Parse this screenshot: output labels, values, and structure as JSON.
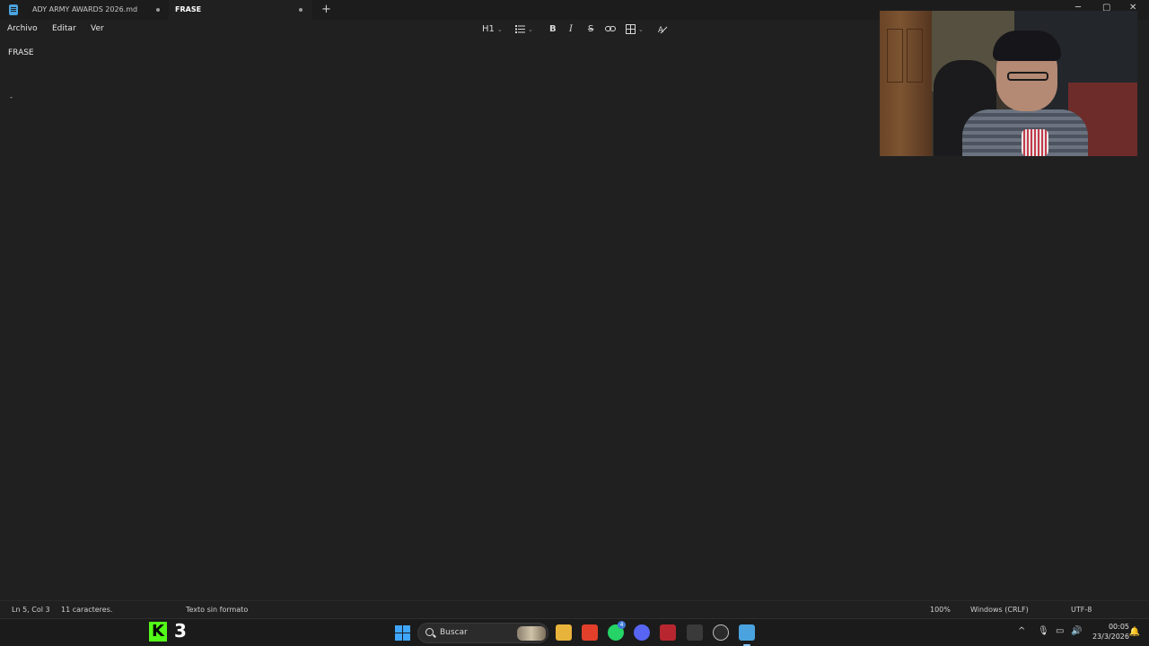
{
  "tabs": [
    {
      "label": "ADY ARMY AWARDS 2026.md",
      "active": false
    },
    {
      "label": "FRASE",
      "active": true
    }
  ],
  "new_tab_symbol": "+",
  "window_controls": {
    "minimize": "─",
    "maximize": "▢",
    "close": "✕"
  },
  "menu": {
    "file": "Archivo",
    "edit": "Editar",
    "view": "Ver"
  },
  "toolbar": {
    "heading": "H1",
    "list_icon": "list-icon",
    "bold": "B",
    "italic": "I",
    "strike": "S",
    "link_icon": "link-icon",
    "table_icon": "table-icon",
    "format_icon": "clear-format-icon"
  },
  "editor": {
    "line1": "FRASE",
    "line5": "-"
  },
  "statusbar": {
    "position": "Ln 5, Col 3",
    "chars": "11 caracteres.",
    "format": "Texto sin formato",
    "zoom": "100%",
    "line_ending": "Windows (CRLF)",
    "encoding": "UTF-8"
  },
  "taskbar": {
    "kick_logo": "K",
    "kick_count": "3",
    "search_placeholder": "Buscar",
    "time": "00:05",
    "date": "23/3/2026",
    "whatsapp_badge": "4",
    "tray_chevron": "^"
  },
  "colors": {
    "background": "#202020",
    "accent": "#3fa6ff",
    "kick_green": "#53fc18"
  }
}
